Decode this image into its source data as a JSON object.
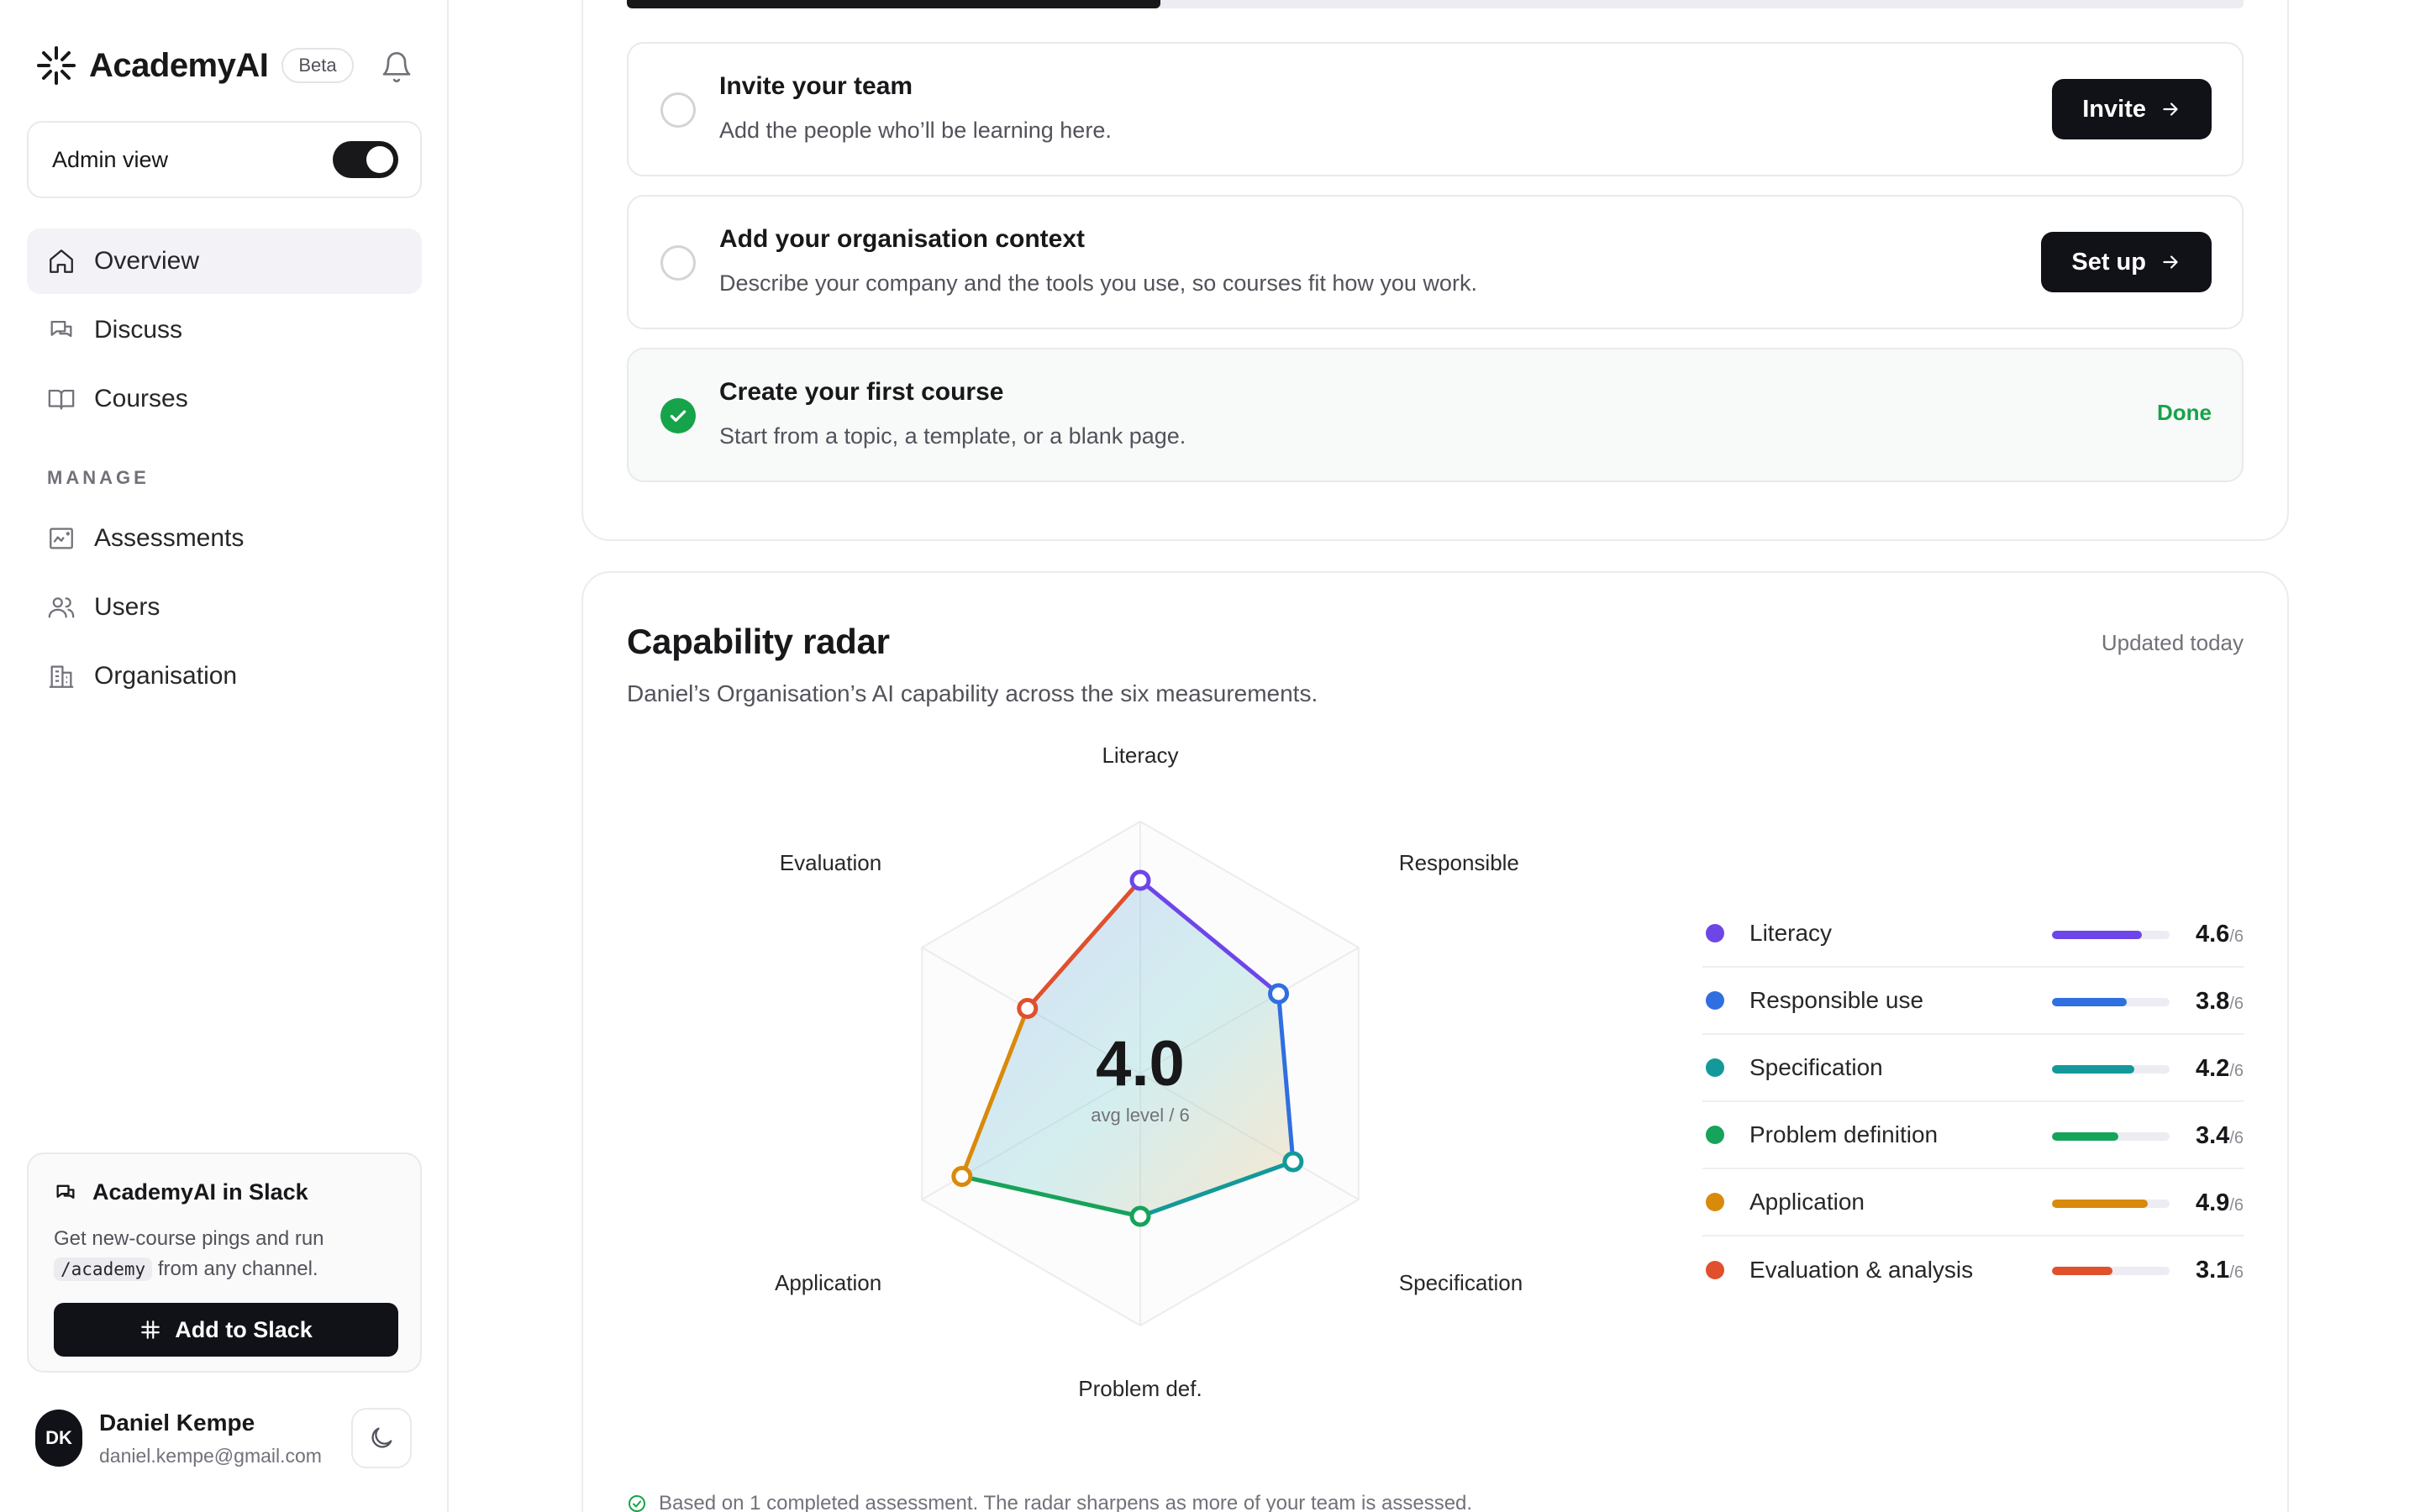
{
  "brand": {
    "name": "AcademyAI",
    "badge": "Beta"
  },
  "admin": {
    "label": "Admin view",
    "enabled": true
  },
  "nav": {
    "primary": [
      {
        "label": "Overview",
        "icon": "home-icon",
        "active": true
      },
      {
        "label": "Discuss",
        "icon": "chat-icon",
        "active": false
      },
      {
        "label": "Courses",
        "icon": "book-icon",
        "active": false
      }
    ],
    "section_label": "MANAGE",
    "manage": [
      {
        "label": "Assessments",
        "icon": "assessment-icon"
      },
      {
        "label": "Users",
        "icon": "users-icon"
      },
      {
        "label": "Organisation",
        "icon": "building-icon"
      }
    ]
  },
  "slack": {
    "title": "AcademyAI in Slack",
    "desc_pre": "Get new-course pings and run",
    "command": "/academy",
    "desc_post": "from any channel.",
    "button": "Add to Slack"
  },
  "user": {
    "initials": "DK",
    "name": "Daniel Kempe",
    "email": "daniel.kempe@gmail.com"
  },
  "onboarding": {
    "progress": 0.33,
    "tasks": [
      {
        "title": "Invite your team",
        "desc": "Add the people who’ll be learning here.",
        "action": "Invite",
        "done": false
      },
      {
        "title": "Add your organisation context",
        "desc": "Describe your company and the tools you use, so courses fit how you work.",
        "action": "Set up",
        "done": false
      },
      {
        "title": "Create your first course",
        "desc": "Start from a topic, a template, or a blank page.",
        "action": "Done",
        "done": true
      }
    ]
  },
  "radar": {
    "title": "Capability radar",
    "updated": "Updated today",
    "subtitle": "Daniel’s Organisation’s AI capability across the six measurements.",
    "avg_value": "4.0",
    "avg_label": "avg level / 6",
    "max": 6,
    "max_label": "/6",
    "footnote": "Based on 1 completed assessment. The radar sharpens as more of your team is assessed."
  },
  "chart_data": {
    "type": "radar",
    "title": "Capability radar",
    "range": [
      0,
      6
    ],
    "axes": [
      "Literacy",
      "Responsible",
      "Specification",
      "Problem def.",
      "Application",
      "Evaluation"
    ],
    "series": [
      {
        "values": [
          4.6,
          3.8,
          4.2,
          3.4,
          4.9,
          3.1
        ],
        "labels": [
          "Literacy",
          "Responsible use",
          "Specification",
          "Problem definition",
          "Application",
          "Evaluation & analysis"
        ],
        "colors": [
          "#6d46e8",
          "#2f6fe0",
          "#14999a",
          "#16a35a",
          "#d98a0b",
          "#e0502c"
        ]
      }
    ],
    "values_text": [
      "4.6",
      "3.8",
      "4.2",
      "3.4",
      "4.9",
      "3.1"
    ]
  }
}
